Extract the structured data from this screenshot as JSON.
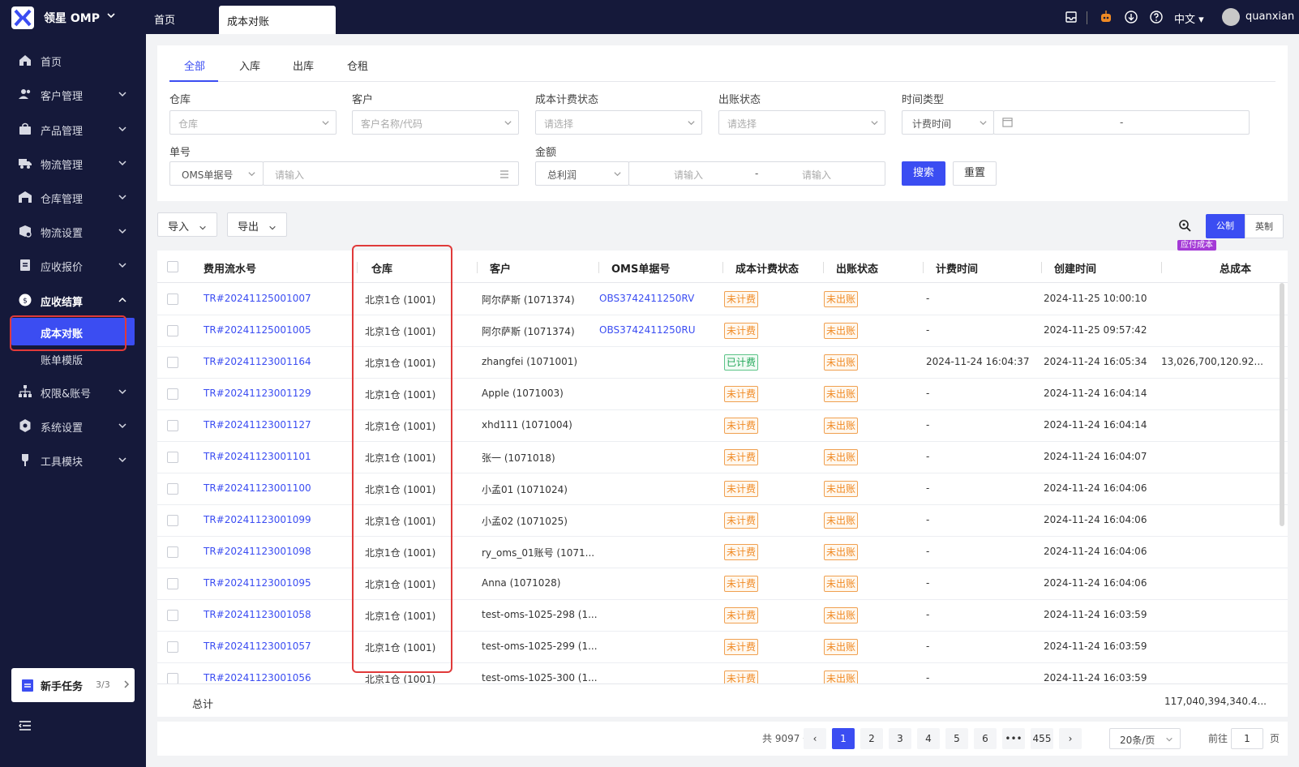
{
  "brand": {
    "name": "领星 OMP"
  },
  "top_tabs": {
    "home": "首页",
    "active": "成本对账"
  },
  "top_right": {
    "lang": "中文",
    "user": "quanxian"
  },
  "sidebar": {
    "items": [
      {
        "label": "首页"
      },
      {
        "label": "客户管理"
      },
      {
        "label": "产品管理"
      },
      {
        "label": "物流管理"
      },
      {
        "label": "仓库管理"
      },
      {
        "label": "物流设置"
      },
      {
        "label": "应收报价"
      },
      {
        "label": "应收结算"
      },
      {
        "label": "权限&账号"
      },
      {
        "label": "系统设置"
      },
      {
        "label": "工具模块"
      }
    ],
    "sub_items": [
      {
        "label": "成本对账"
      },
      {
        "label": "账单模版"
      }
    ],
    "task": {
      "label": "新手任务",
      "count": "3/3"
    }
  },
  "filter": {
    "tabs": [
      "全部",
      "入库",
      "出库",
      "仓租"
    ],
    "warehouse": {
      "label": "仓库",
      "placeholder": "仓库"
    },
    "customer": {
      "label": "客户",
      "placeholder": "客户名称/代码"
    },
    "cost_status": {
      "label": "成本计费状态",
      "placeholder": "请选择"
    },
    "bill_status": {
      "label": "出账状态",
      "placeholder": "请选择"
    },
    "time_type": {
      "label": "时间类型",
      "value": "计费时间",
      "range_sep": "-"
    },
    "order_no": {
      "label": "单号",
      "type": "OMS单据号",
      "placeholder": "请输入"
    },
    "amount": {
      "label": "金额",
      "type": "总利润",
      "min_placeholder": "请输入",
      "sep": "-",
      "max_placeholder": "请输入"
    },
    "search": "搜索",
    "reset": "重置"
  },
  "toolbar": {
    "import": "导入",
    "export": "导出",
    "unit_metric": "公制",
    "unit_imperial": "英制",
    "badge": "应付成本"
  },
  "table": {
    "columns": [
      "费用流水号",
      "仓库",
      "客户",
      "OMS单据号",
      "成本计费状态",
      "出账状态",
      "计费时间",
      "创建时间",
      "总成本"
    ],
    "rows": [
      {
        "id": "TR#20241125001007",
        "warehouse": "北京1仓 (1001)",
        "customer": "阿尔萨斯 (1071374)",
        "oms": "OBS3742411250RV",
        "cost_status": "未计费",
        "bill_status": "未出账",
        "bill_time": "-",
        "created": "2024-11-25 10:00:10",
        "total": ""
      },
      {
        "id": "TR#20241125001005",
        "warehouse": "北京1仓 (1001)",
        "customer": "阿尔萨斯 (1071374)",
        "oms": "OBS3742411250RU",
        "cost_status": "未计费",
        "bill_status": "未出账",
        "bill_time": "-",
        "created": "2024-11-25 09:57:42",
        "total": ""
      },
      {
        "id": "TR#20241123001164",
        "warehouse": "北京1仓 (1001)",
        "customer": "zhangfei (1071001)",
        "oms": "",
        "cost_status": "已计费",
        "bill_status": "未出账",
        "bill_time": "2024-11-24 16:04:37",
        "created": "2024-11-24 16:05:34",
        "total": "13,026,700,120.92..."
      },
      {
        "id": "TR#20241123001129",
        "warehouse": "北京1仓 (1001)",
        "customer": "Apple (1071003)",
        "oms": "",
        "cost_status": "未计费",
        "bill_status": "未出账",
        "bill_time": "-",
        "created": "2024-11-24 16:04:14",
        "total": ""
      },
      {
        "id": "TR#20241123001127",
        "warehouse": "北京1仓 (1001)",
        "customer": "xhd111 (1071004)",
        "oms": "",
        "cost_status": "未计费",
        "bill_status": "未出账",
        "bill_time": "-",
        "created": "2024-11-24 16:04:14",
        "total": ""
      },
      {
        "id": "TR#20241123001101",
        "warehouse": "北京1仓 (1001)",
        "customer": "张一 (1071018)",
        "oms": "",
        "cost_status": "未计费",
        "bill_status": "未出账",
        "bill_time": "-",
        "created": "2024-11-24 16:04:07",
        "total": ""
      },
      {
        "id": "TR#20241123001100",
        "warehouse": "北京1仓 (1001)",
        "customer": "小孟01 (1071024)",
        "oms": "",
        "cost_status": "未计费",
        "bill_status": "未出账",
        "bill_time": "-",
        "created": "2024-11-24 16:04:06",
        "total": ""
      },
      {
        "id": "TR#20241123001099",
        "warehouse": "北京1仓 (1001)",
        "customer": "小孟02 (1071025)",
        "oms": "",
        "cost_status": "未计费",
        "bill_status": "未出账",
        "bill_time": "-",
        "created": "2024-11-24 16:04:06",
        "total": ""
      },
      {
        "id": "TR#20241123001098",
        "warehouse": "北京1仓 (1001)",
        "customer": "ry_oms_01账号 (1071...",
        "oms": "",
        "cost_status": "未计费",
        "bill_status": "未出账",
        "bill_time": "-",
        "created": "2024-11-24 16:04:06",
        "total": ""
      },
      {
        "id": "TR#20241123001095",
        "warehouse": "北京1仓 (1001)",
        "customer": "Anna (1071028)",
        "oms": "",
        "cost_status": "未计费",
        "bill_status": "未出账",
        "bill_time": "-",
        "created": "2024-11-24 16:04:06",
        "total": ""
      },
      {
        "id": "TR#20241123001058",
        "warehouse": "北京1仓 (1001)",
        "customer": "test-oms-1025-298 (1...",
        "oms": "",
        "cost_status": "未计费",
        "bill_status": "未出账",
        "bill_time": "-",
        "created": "2024-11-24 16:03:59",
        "total": ""
      },
      {
        "id": "TR#20241123001057",
        "warehouse": "北京1仓 (1001)",
        "customer": "test-oms-1025-299 (1...",
        "oms": "",
        "cost_status": "未计费",
        "bill_status": "未出账",
        "bill_time": "-",
        "created": "2024-11-24 16:03:59",
        "total": ""
      },
      {
        "id": "TR#20241123001056",
        "warehouse": "北京1仓 (1001)",
        "customer": "test-oms-1025-300 (1...",
        "oms": "",
        "cost_status": "未计费",
        "bill_status": "未出账",
        "bill_time": "-",
        "created": "2024-11-24 16:03:59",
        "total": ""
      }
    ],
    "footer": {
      "label": "总计",
      "total": "117,040,394,340.4..."
    }
  },
  "pagination": {
    "total": "共 9097 条",
    "pages": [
      "1",
      "2",
      "3",
      "4",
      "5",
      "6",
      "•••",
      "455"
    ],
    "size": "20条/页",
    "goto_label": "前往",
    "goto_value": "1",
    "goto_suffix": "页"
  },
  "colors": {
    "accent": "#3b4df2",
    "sidebar_bg": "#15193a",
    "highlight": "#e03a3a"
  }
}
